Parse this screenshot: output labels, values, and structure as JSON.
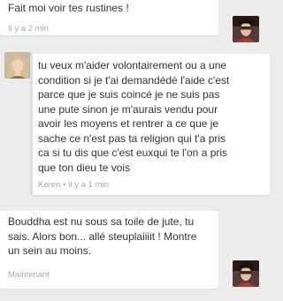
{
  "messages": [
    {
      "text": "Fait moi voir tes rustines !",
      "meta": "Il y a 2 min",
      "avatar": "user-avatar-dark-hair"
    },
    {
      "text": "tu veux m'aider volontairement ou a une\ncondition si je t'ai demandédé l'aide c'est\nparce que je suis coincé je ne suis pas\nune pute sinon je m'aurais vendu pour\navoir les moyens et rentrer a ce que je\nsache ce n'est pas ta religion qui t'a pris\nca si tu dis que c'est euxqui te l'on a pris\nque ton dieu te vois",
      "meta": "Keren • Il y a 1 min",
      "avatar": "user-avatar-blonde"
    },
    {
      "text": "Bouddha est nu sous sa toile de jute, tu\nsais. Alors bon... allé steuplaiiiit ! Montre\nun sein au moins.",
      "meta": "Maintenant",
      "avatar": "user-avatar-dark-hair"
    }
  ],
  "colors": {
    "background": "#ececec",
    "bubble": "#ffffff",
    "text": "#333333",
    "meta": "#a8a8a8"
  }
}
